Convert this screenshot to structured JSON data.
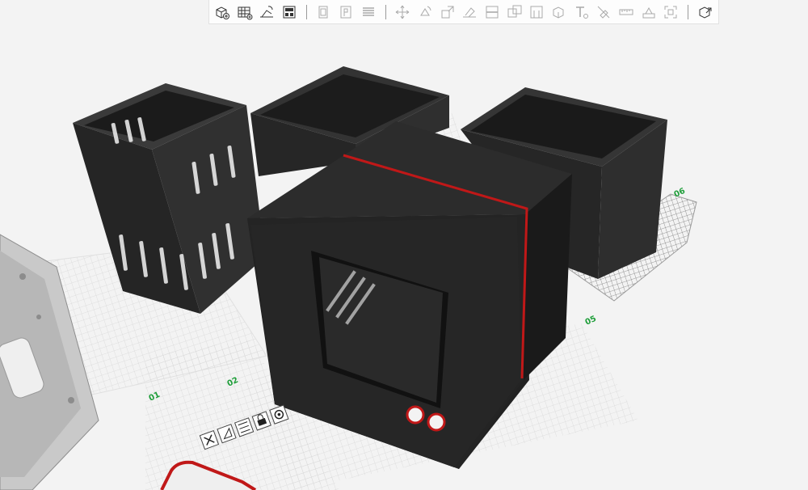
{
  "toolbar": {
    "left_group": [
      {
        "name": "add-object-icon"
      },
      {
        "name": "add-plate-icon"
      },
      {
        "name": "auto-orient-icon"
      },
      {
        "name": "arrange-icon"
      }
    ],
    "middle_group": [
      {
        "name": "copy-icon"
      },
      {
        "name": "paste-icon"
      },
      {
        "name": "layers-icon"
      }
    ],
    "right_group": [
      {
        "name": "move-icon"
      },
      {
        "name": "rotate-icon"
      },
      {
        "name": "scale-icon"
      },
      {
        "name": "lay-on-face-icon"
      },
      {
        "name": "cut-icon"
      },
      {
        "name": "boolean-icon"
      },
      {
        "name": "support-paint-icon"
      },
      {
        "name": "seam-paint-icon"
      },
      {
        "name": "text-icon"
      },
      {
        "name": "color-paint-icon"
      },
      {
        "name": "measure-icon"
      },
      {
        "name": "assembly-icon"
      },
      {
        "name": "fit-view-icon"
      }
    ],
    "far_right": [
      {
        "name": "variable-layer-icon"
      }
    ]
  },
  "plates": {
    "labels": [
      "01",
      "02",
      "05",
      "06"
    ]
  },
  "plate_tools": [
    {
      "name": "delete-plate-icon"
    },
    {
      "name": "orient-plate-icon"
    },
    {
      "name": "arrange-plate-icon"
    },
    {
      "name": "lock-plate-icon"
    },
    {
      "name": "plate-settings-icon"
    }
  ],
  "colors": {
    "background": "#f3f3f3",
    "object": "#2b2b2b",
    "object_dark": "#161616",
    "accent_seam": "#c01818",
    "plate_label": "#1f9e3a",
    "grid": "#d8d8d8"
  }
}
